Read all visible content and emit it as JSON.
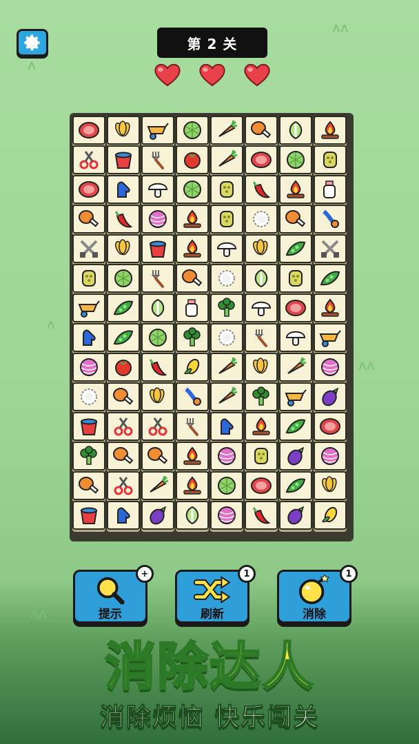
{
  "header": {
    "level_label": "第 2 关",
    "lives": 3
  },
  "board": {
    "cols": 8,
    "rows": 14,
    "tiles": [
      [
        "meat",
        "wheat",
        "wheelbarrow",
        "cabbage",
        "carrot",
        "drumstick",
        "napa",
        "campfire"
      ],
      [
        "scissors",
        "bucket",
        "fork",
        "tomato",
        "carrot",
        "meat",
        "cabbage",
        "lotus"
      ],
      [
        "meat",
        "glove",
        "mushroom",
        "cabbage",
        "lotus",
        "pepper",
        "campfire",
        "bottle"
      ],
      [
        "drumstick",
        "pepper",
        "yarn",
        "campfire",
        "lotus",
        "cauliflower",
        "drumstick",
        "hose"
      ],
      [
        "cutlery",
        "wheat",
        "bucket",
        "campfire",
        "mushroom",
        "wheat",
        "peapod",
        "cutlery"
      ],
      [
        "lotus",
        "cabbage",
        "fork",
        "drumstick",
        "cauliflower",
        "napa",
        "lotus",
        "peapod"
      ],
      [
        "wheelbarrow",
        "peapod",
        "napa",
        "bottle",
        "broccoli",
        "mushroom",
        "meat",
        "campfire"
      ],
      [
        "glove",
        "peapod",
        "cabbage",
        "broccoli",
        "cauliflower",
        "fork",
        "mushroom",
        "wheelbarrow"
      ],
      [
        "yarn",
        "tomato",
        "pepper",
        "corn",
        "carrot",
        "wheat",
        "carrot",
        "yarn"
      ],
      [
        "cauliflower",
        "drumstick",
        "wheat",
        "hose",
        "carrot",
        "broccoli",
        "wheelbarrow",
        "eggplant"
      ],
      [
        "bucket",
        "scissors",
        "scissors",
        "fork",
        "glove",
        "campfire",
        "peapod",
        "meat"
      ],
      [
        "broccoli",
        "drumstick",
        "drumstick",
        "campfire",
        "yarn",
        "lotus",
        "eggplant",
        "yarn"
      ],
      [
        "drumstick",
        "scissors",
        "carrot",
        "campfire",
        "cabbage",
        "meat",
        "peapod",
        "wheat"
      ],
      [
        "bucket",
        "glove",
        "eggplant",
        "napa",
        "yarn",
        "pepper",
        "eggplant",
        "corn"
      ]
    ]
  },
  "tools": [
    {
      "label": "提示",
      "icon": "magnifier-icon",
      "badge": "+"
    },
    {
      "label": "刷新",
      "icon": "shuffle-icon",
      "badge": "1"
    },
    {
      "label": "消除",
      "icon": "bomb-icon",
      "badge": "1"
    }
  ],
  "banner": {
    "title": "消除达人",
    "subtitle": "消除烦恼 快乐闯关"
  },
  "colors": {
    "accent": "#2e9fd8",
    "heart": "#e8414a",
    "tile": "#f7f2d6"
  }
}
